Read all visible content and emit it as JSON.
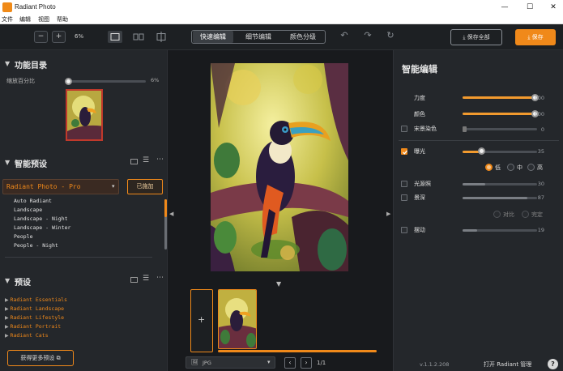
{
  "window": {
    "title": "Radiant Photo",
    "min": "—",
    "max": "☐",
    "close": "✕"
  },
  "menu": [
    "文件",
    "编辑",
    "视图",
    "帮助"
  ],
  "toolbar": {
    "zoom_out": "−",
    "zoom_in": "+",
    "zoom_value": "6%",
    "mode_tabs": [
      "快速编辑",
      "细节编辑",
      "颜色分级"
    ],
    "save_as": "保存全部",
    "save": "保存"
  },
  "left": {
    "catalog_title": "功能目录",
    "zoom_label": "缩放百分比",
    "zoom_value": "6%",
    "zoom_fraction": 0.06,
    "presets_title": "智能预设",
    "preset_select": "Radiant Photo - Pro",
    "applied_button": "已施加",
    "preset_items": [
      "Auto Radiant",
      "Landscape",
      "Landscape - Night",
      "Landscape - Winter",
      "People",
      "People - Night"
    ],
    "presets2_title": "预设",
    "preset_groups": [
      "Radiant Essentials",
      "Radiant Landscape",
      "Radiant Lifestyle",
      "Radiant Portrait",
      "Radiant Cats"
    ],
    "get_more_button": "获得更多预设"
  },
  "center": {
    "add_label": "+",
    "file_format": "JPG",
    "page_label": "1/1"
  },
  "right": {
    "title": "智能编辑",
    "sliders": [
      {
        "label": "力度",
        "value": "100",
        "fraction": 1.0,
        "checkbox": false,
        "checked": false
      },
      {
        "label": "颜色",
        "value": "100",
        "fraction": 1.0,
        "checkbox": false,
        "checked": false
      },
      {
        "label": "宋景染色",
        "value": "0",
        "fraction": 0.0,
        "checkbox": true,
        "checked": false
      },
      {
        "label": "曝光",
        "value": "35",
        "fraction": 0.35,
        "checkbox": true,
        "checked": true
      }
    ],
    "exposure_modes": [
      "低",
      "中",
      "高"
    ],
    "sliders2": [
      {
        "label": "光源照",
        "value": "30",
        "fraction": 0.3,
        "checked": false
      },
      {
        "label": "景深",
        "value": "87",
        "fraction": 0.87,
        "checked": false
      }
    ],
    "depth_modes": [
      "对比",
      "完定"
    ],
    "sliders3": [
      {
        "label": "摆动",
        "value": "19",
        "fraction": 0.19,
        "checked": false
      }
    ],
    "version": "v.1.1.2.208",
    "open_manager": "打开 Radiant 管理",
    "help": "?"
  },
  "colors": {
    "accent": "#f0891a",
    "panel": "#24272b",
    "background": "#181a1d"
  }
}
